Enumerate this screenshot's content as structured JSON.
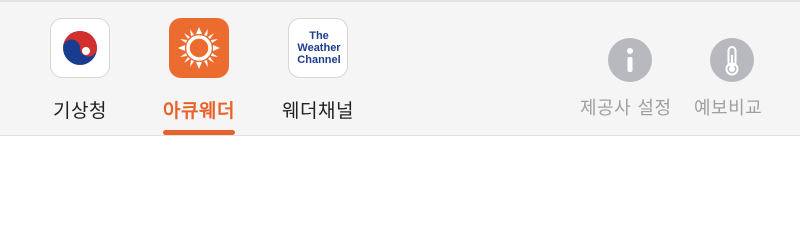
{
  "providers": [
    {
      "id": "kma",
      "label": "기상청",
      "active": false
    },
    {
      "id": "accuweather",
      "label": "아큐웨더",
      "active": true
    },
    {
      "id": "weather_channel",
      "label": "웨더채널",
      "active": false,
      "logo_lines": [
        "The",
        "Weather",
        "Channel"
      ]
    }
  ],
  "utilities": {
    "provider_settings_label": "제공사 설정",
    "compare_forecast_label": "예보비교"
  },
  "colors": {
    "accent": "#e8632b",
    "kma_red": "#d32f2f",
    "kma_blue": "#1a3c8f",
    "twc_blue": "#1d3d8f",
    "util_gray": "#b7b9bf"
  },
  "icons": {
    "kma": "taegeuk-logo-icon",
    "accuweather": "sun-logo-icon",
    "provider_settings": "info-icon",
    "compare_forecast": "thermometer-icon"
  }
}
